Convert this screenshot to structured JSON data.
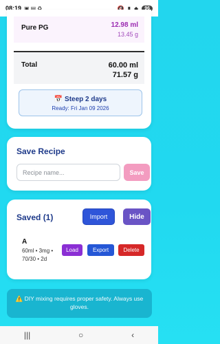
{
  "status_bar": {
    "time": "08:19",
    "icons": [
      "screenshot-icon",
      "image-icon",
      "recycle-icon"
    ],
    "right_icons": [
      "mute-icon",
      "signal-icon",
      "wifi-icon"
    ],
    "battery": "96"
  },
  "ingredients": {
    "pg": {
      "label": "Pure PG",
      "volume": "12.98 ml",
      "weight": "13.45 g"
    },
    "total": {
      "label": "Total",
      "volume": "60.00 ml",
      "weight": "71.57 g"
    }
  },
  "steep": {
    "icon": "📅",
    "title": "Steep 2 days",
    "ready": "Ready: Fri Jan 09 2026"
  },
  "save_recipe": {
    "title": "Save Recipe",
    "input_placeholder": "Recipe name...",
    "input_value": "",
    "save_label": "Save"
  },
  "saved": {
    "title": "Saved (1)",
    "import_label": "Import",
    "hide_label": "Hide",
    "items": [
      {
        "name": "A",
        "meta": "60ml • 3mg • 70/30 • 2d",
        "load": "Load",
        "export": "Export",
        "delete": "Delete"
      }
    ]
  },
  "warning": {
    "icon": "⚠️",
    "text": "DIY mixing requires proper safety. Always use gloves."
  },
  "nav": {
    "recents": "|||",
    "home": "○",
    "back": "‹"
  },
  "colors": {
    "background": "#22d6ee",
    "title_blue": "#1e3a8a",
    "pg_purple": "#9b2bb1",
    "save_pink": "#f39cc0",
    "import_blue": "#2f55d9",
    "hide_purple": "#6a54c5",
    "load_purple": "#8b2fd4",
    "export_blue": "#2557d6",
    "delete_red": "#d62828",
    "warning_bg": "#19b5d0"
  }
}
